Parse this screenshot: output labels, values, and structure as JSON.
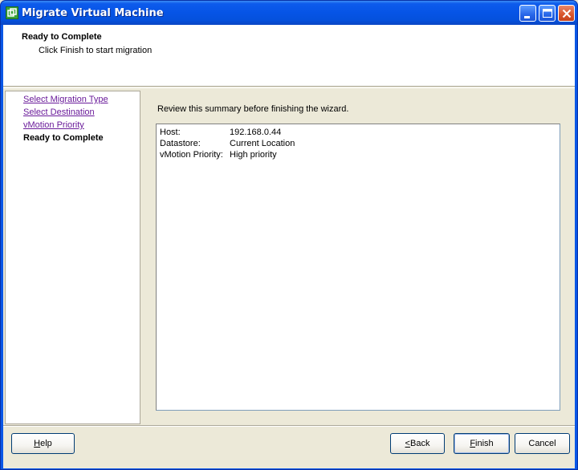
{
  "window": {
    "title": "Migrate Virtual Machine"
  },
  "header": {
    "title": "Ready to Complete",
    "subtitle": "Click Finish to start migration"
  },
  "nav": {
    "items": [
      {
        "label": "Select Migration Type",
        "state": "link"
      },
      {
        "label": "Select Destination",
        "state": "link"
      },
      {
        "label": "vMotion Priority",
        "state": "link"
      },
      {
        "label": "Ready to Complete",
        "state": "current"
      }
    ]
  },
  "content": {
    "instruction": "Review this summary before finishing the wizard.",
    "summary": [
      {
        "key": "Host:",
        "value": "192.168.0.44"
      },
      {
        "key": "Datastore:",
        "value": "Current Location"
      },
      {
        "key": "vMotion Priority:",
        "value": "High priority"
      }
    ]
  },
  "buttons": {
    "help": {
      "accel": "H",
      "rest": "elp"
    },
    "back": {
      "accel": "<",
      "rest": " Back"
    },
    "finish": {
      "accel": "F",
      "rest": "inish"
    },
    "cancel": "Cancel"
  },
  "colors": {
    "titlebar": "#0654e6",
    "link": "#6a1b9a",
    "dialog_bg": "#ece9d8"
  }
}
